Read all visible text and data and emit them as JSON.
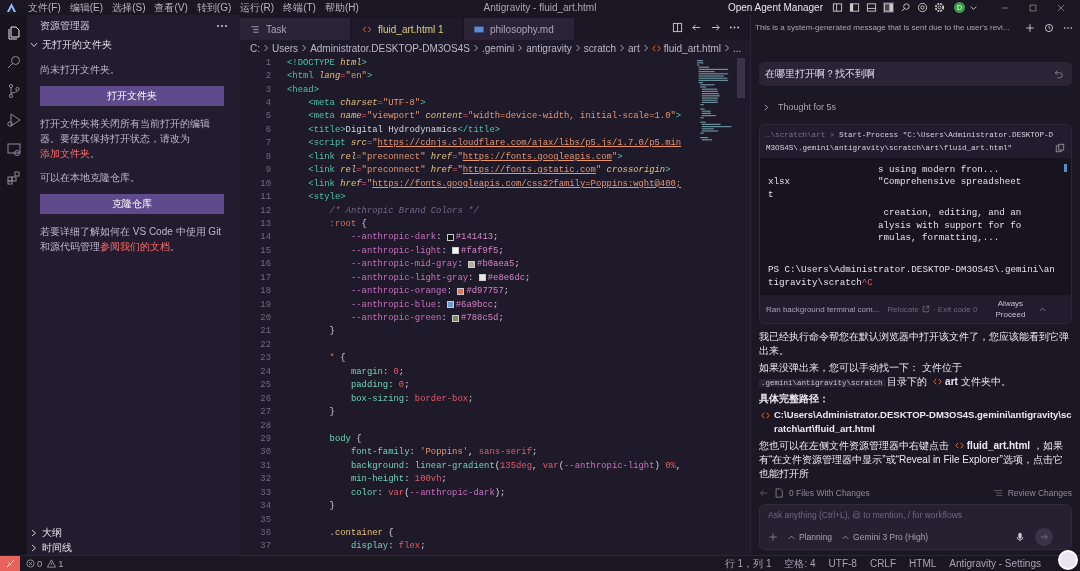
{
  "titlebar": {
    "menus": [
      "文件(F)",
      "编辑(E)",
      "选择(S)",
      "查看(V)",
      "转到(G)",
      "运行(R)",
      "终端(T)",
      "帮助(H)"
    ],
    "title": "Antigravity - fluid_art.html",
    "agent_manager": "Open Agent Manager",
    "account": "D"
  },
  "activity_bar": [
    {
      "kind": "files",
      "selected": true
    },
    {
      "kind": "search",
      "selected": false
    },
    {
      "kind": "git",
      "selected": false
    },
    {
      "kind": "run",
      "selected": false
    },
    {
      "kind": "remote",
      "selected": false
    },
    {
      "kind": "extensions",
      "selected": false
    }
  ],
  "sidebar": {
    "title": "资源管理器",
    "section": {
      "title": "无打开的文件夹",
      "expanded": true
    },
    "no_folder": "尚未打开文件夹。",
    "open_button": "打开文件夹",
    "open_note": [
      {
        "t": "打开文件夹将关闭所有当前打开的编辑器。要使其保持打开状态，请改为 ",
        "link": false
      },
      {
        "t": "添加文件夹",
        "link": true
      },
      {
        "t": "。",
        "link": false
      }
    ],
    "clone_text": "可以在本地克隆仓库。",
    "clone_button": "克隆仓库",
    "docs_note": [
      {
        "t": "若要详细了解如何在 VS Code 中使用 Git 和源代码管理",
        "link": false
      },
      {
        "t": "参阅我们的文档",
        "link": true
      },
      {
        "t": "。",
        "link": false
      }
    ],
    "bottom_sections": [
      {
        "title": "大纲",
        "expanded": false
      },
      {
        "title": "时间线",
        "expanded": false
      }
    ]
  },
  "editor": {
    "tabs": [
      {
        "label": "Task",
        "kind": "task",
        "selected": false
      },
      {
        "label": "fluid_art.html",
        "badge": "1",
        "kind": "html",
        "selected": true
      },
      {
        "label": "philosophy.md",
        "kind": "md",
        "selected": false
      }
    ],
    "breadcrumb": [
      {
        "t": "C:",
        "kind": "folder"
      },
      {
        "t": "Users",
        "kind": "folder"
      },
      {
        "t": "Administrator.DESKTOP-DM3OS4S",
        "kind": "folder"
      },
      {
        "t": ".gemini",
        "kind": "folder"
      },
      {
        "t": "antigravity",
        "kind": "folder"
      },
      {
        "t": "scratch",
        "kind": "folder"
      },
      {
        "t": "art",
        "kind": "folder"
      },
      {
        "t": "fluid_art.html",
        "kind": "file"
      },
      {
        "t": "...",
        "kind": "more"
      }
    ],
    "lines": [
      {
        "n": "1",
        "tokens": [
          {
            "t": "<!DOCTYPE ",
            "kind": "tag"
          },
          {
            "t": "html",
            "kind": "attr"
          },
          {
            "t": ">",
            "kind": "tag"
          }
        ]
      },
      {
        "n": "2",
        "tokens": [
          {
            "t": "<html ",
            "kind": "tag"
          },
          {
            "t": "lang",
            "kind": "attr"
          },
          {
            "t": "=",
            "kind": "eq"
          },
          {
            "t": "\"en\"",
            "kind": "str"
          },
          {
            "t": ">",
            "kind": "tag"
          }
        ]
      },
      {
        "n": "3",
        "tokens": [
          {
            "t": "<head>",
            "kind": "tag"
          }
        ]
      },
      {
        "n": "4",
        "tokens": [
          {
            "t": "    <meta ",
            "kind": "tag"
          },
          {
            "t": "charset",
            "kind": "attr"
          },
          {
            "t": "=",
            "kind": "eq"
          },
          {
            "t": "\"UTF-8\"",
            "kind": "str"
          },
          {
            "t": ">",
            "kind": "tag"
          }
        ]
      },
      {
        "n": "5",
        "tokens": [
          {
            "t": "    <meta ",
            "kind": "tag"
          },
          {
            "t": "name",
            "kind": "attr"
          },
          {
            "t": "=",
            "kind": "eq"
          },
          {
            "t": "\"viewport\" ",
            "kind": "str"
          },
          {
            "t": "content",
            "kind": "attr"
          },
          {
            "t": "=",
            "kind": "eq"
          },
          {
            "t": "\"width=device-width, initial-scale=1.0\"",
            "kind": "str"
          },
          {
            "t": ">",
            "kind": "tag"
          }
        ]
      },
      {
        "n": "6",
        "tokens": [
          {
            "t": "    <title>",
            "kind": "tag"
          },
          {
            "t": "Digital Hydrodynamics",
            "kind": "text"
          },
          {
            "t": "</title>",
            "kind": "tag"
          }
        ]
      },
      {
        "n": "7",
        "tokens": [
          {
            "t": "    <script ",
            "kind": "tag"
          },
          {
            "t": "src",
            "kind": "attr"
          },
          {
            "t": "=",
            "kind": "eq"
          },
          {
            "t": "\"",
            "kind": "str"
          },
          {
            "t": "https://cdnjs.cloudflare.com/ajax/libs/p5.js/1.7.0/p5.min",
            "kind": "url"
          }
        ]
      },
      {
        "n": "8",
        "tokens": [
          {
            "t": "    <link ",
            "kind": "tag"
          },
          {
            "t": "rel",
            "kind": "attr"
          },
          {
            "t": "=",
            "kind": "eq"
          },
          {
            "t": "\"preconnect\" ",
            "kind": "str"
          },
          {
            "t": "href",
            "kind": "attr"
          },
          {
            "t": "=",
            "kind": "eq"
          },
          {
            "t": "\"",
            "kind": "str"
          },
          {
            "t": "https://fonts.googleapis.com",
            "kind": "url"
          },
          {
            "t": "\"",
            "kind": "str"
          },
          {
            "t": ">",
            "kind": "tag"
          }
        ]
      },
      {
        "n": "9",
        "tokens": [
          {
            "t": "    <link ",
            "kind": "tag"
          },
          {
            "t": "rel",
            "kind": "attr"
          },
          {
            "t": "=",
            "kind": "eq"
          },
          {
            "t": "\"preconnect\" ",
            "kind": "str"
          },
          {
            "t": "href",
            "kind": "attr"
          },
          {
            "t": "=",
            "kind": "eq"
          },
          {
            "t": "\"",
            "kind": "str"
          },
          {
            "t": "https://fonts.gstatic.com",
            "kind": "url"
          },
          {
            "t": "\" ",
            "kind": "str"
          },
          {
            "t": "crossorigin",
            "kind": "attr"
          },
          {
            "t": ">",
            "kind": "tag"
          }
        ]
      },
      {
        "n": "10",
        "tokens": [
          {
            "t": "    <link ",
            "kind": "tag"
          },
          {
            "t": "href",
            "kind": "attr"
          },
          {
            "t": "=",
            "kind": "eq"
          },
          {
            "t": "\"",
            "kind": "str"
          },
          {
            "t": "https://fonts.googleapis.com/css2?family=Poppins:wght@400;",
            "kind": "url"
          }
        ]
      },
      {
        "n": "11",
        "tokens": [
          {
            "t": "    <style>",
            "kind": "tag"
          }
        ]
      },
      {
        "n": "12",
        "tokens": [
          {
            "t": "        /* Anthropic Brand Colors */",
            "kind": "comment"
          }
        ]
      },
      {
        "n": "13",
        "tokens": [
          {
            "t": "        :root",
            "kind": "sel"
          },
          {
            "t": " {",
            "kind": "text"
          }
        ]
      },
      {
        "n": "14",
        "tokens": [
          {
            "t": "            --anthropic-dark",
            "kind": "var"
          },
          {
            "t": ": ",
            "kind": "text"
          },
          {
            "kind": "swatch",
            "color": "#141413"
          },
          {
            "t": "#141413",
            "kind": "hex"
          },
          {
            "t": ";",
            "kind": "text"
          }
        ]
      },
      {
        "n": "15",
        "tokens": [
          {
            "t": "            --anthropic-light",
            "kind": "var"
          },
          {
            "t": ": ",
            "kind": "text"
          },
          {
            "kind": "swatch",
            "color": "#faf9f5"
          },
          {
            "t": "#faf9f5",
            "kind": "hex"
          },
          {
            "t": ";",
            "kind": "text"
          }
        ]
      },
      {
        "n": "16",
        "tokens": [
          {
            "t": "            --anthropic-mid-gray",
            "kind": "var"
          },
          {
            "t": ": ",
            "kind": "text"
          },
          {
            "kind": "swatch",
            "color": "#b0aea5"
          },
          {
            "t": "#b0aea5",
            "kind": "hex"
          },
          {
            "t": ";",
            "kind": "text"
          }
        ]
      },
      {
        "n": "17",
        "tokens": [
          {
            "t": "            --anthropic-light-gray",
            "kind": "var"
          },
          {
            "t": ": ",
            "kind": "text"
          },
          {
            "kind": "swatch",
            "color": "#e8e6dc"
          },
          {
            "t": "#e8e6dc",
            "kind": "hex"
          },
          {
            "t": ";",
            "kind": "text"
          }
        ]
      },
      {
        "n": "18",
        "tokens": [
          {
            "t": "            --anthropic-orange",
            "kind": "var"
          },
          {
            "t": ": ",
            "kind": "text"
          },
          {
            "kind": "swatch",
            "color": "#d97757"
          },
          {
            "t": "#d97757",
            "kind": "hex"
          },
          {
            "t": ";",
            "kind": "text"
          }
        ]
      },
      {
        "n": "19",
        "tokens": [
          {
            "t": "            --anthropic-blue",
            "kind": "var"
          },
          {
            "t": ": ",
            "kind": "text"
          },
          {
            "kind": "swatch",
            "color": "#6a9bcc"
          },
          {
            "t": "#6a9bcc",
            "kind": "hex"
          },
          {
            "t": ";",
            "kind": "text"
          }
        ]
      },
      {
        "n": "20",
        "tokens": [
          {
            "t": "            --anthropic-green",
            "kind": "var"
          },
          {
            "t": ": ",
            "kind": "text"
          },
          {
            "kind": "swatch",
            "color": "#788c5d"
          },
          {
            "t": "#788c5d",
            "kind": "hex"
          },
          {
            "t": ";",
            "kind": "text"
          }
        ]
      },
      {
        "n": "21",
        "tokens": [
          {
            "t": "        }",
            "kind": "text"
          }
        ]
      },
      {
        "n": "22"
      },
      {
        "n": "23",
        "tokens": [
          {
            "t": "        *",
            "kind": "sel"
          },
          {
            "t": " {",
            "kind": "text"
          }
        ]
      },
      {
        "n": "24",
        "tokens": [
          {
            "t": "            margin",
            "kind": "prop"
          },
          {
            "t": ": ",
            "kind": "text"
          },
          {
            "t": "0",
            "kind": "val"
          },
          {
            "t": ";",
            "kind": "text"
          }
        ]
      },
      {
        "n": "25",
        "tokens": [
          {
            "t": "            padding",
            "kind": "prop"
          },
          {
            "t": ": ",
            "kind": "text"
          },
          {
            "t": "0",
            "kind": "val"
          },
          {
            "t": ";",
            "kind": "text"
          }
        ]
      },
      {
        "n": "26",
        "tokens": [
          {
            "t": "            box-sizing",
            "kind": "prop"
          },
          {
            "t": ": ",
            "kind": "text"
          },
          {
            "t": "border-box",
            "kind": "val"
          },
          {
            "t": ";",
            "kind": "text"
          }
        ]
      },
      {
        "n": "27",
        "tokens": [
          {
            "t": "        }",
            "kind": "text"
          }
        ]
      },
      {
        "n": "28"
      },
      {
        "n": "29",
        "tokens": [
          {
            "t": "        body",
            "kind": "prop"
          },
          {
            "t": " {",
            "kind": "text"
          }
        ]
      },
      {
        "n": "30",
        "tokens": [
          {
            "t": "            font-family",
            "kind": "prop"
          },
          {
            "t": ": ",
            "kind": "text"
          },
          {
            "t": "'Poppins'",
            "kind": "str"
          },
          {
            "t": ", ",
            "kind": "text"
          },
          {
            "t": "sans-serif",
            "kind": "val"
          },
          {
            "t": ";",
            "kind": "text"
          }
        ]
      },
      {
        "n": "31",
        "tokens": [
          {
            "t": "            background",
            "kind": "prop"
          },
          {
            "t": ": ",
            "kind": "text"
          },
          {
            "t": "linear-gradient",
            "kind": "prop"
          },
          {
            "t": "(",
            "kind": "text"
          },
          {
            "t": "135deg",
            "kind": "val"
          },
          {
            "t": ", ",
            "kind": "text"
          },
          {
            "t": "var",
            "kind": "val"
          },
          {
            "t": "(",
            "kind": "text"
          },
          {
            "t": "--anthropic-light",
            "kind": "var"
          },
          {
            "t": ") ",
            "kind": "text"
          },
          {
            "t": "0%",
            "kind": "val"
          },
          {
            "t": ",",
            "kind": "text"
          }
        ]
      },
      {
        "n": "32",
        "tokens": [
          {
            "t": "            min-height",
            "kind": "prop"
          },
          {
            "t": ": ",
            "kind": "text"
          },
          {
            "t": "100vh",
            "kind": "val"
          },
          {
            "t": ";",
            "kind": "text"
          }
        ]
      },
      {
        "n": "33",
        "tokens": [
          {
            "t": "            color",
            "kind": "prop"
          },
          {
            "t": ": ",
            "kind": "text"
          },
          {
            "t": "var",
            "kind": "val"
          },
          {
            "t": "(",
            "kind": "text"
          },
          {
            "t": "--anthropic-dark",
            "kind": "var"
          },
          {
            "t": ");",
            "kind": "text"
          }
        ]
      },
      {
        "n": "34",
        "tokens": [
          {
            "t": "        }",
            "kind": "text"
          }
        ]
      },
      {
        "n": "35"
      },
      {
        "n": "36",
        "tokens": [
          {
            "t": "        .container",
            "kind": "cls"
          },
          {
            "t": " {",
            "kind": "text"
          }
        ]
      },
      {
        "n": "37",
        "tokens": [
          {
            "t": "            display",
            "kind": "prop"
          },
          {
            "t": ": ",
            "kind": "text"
          },
          {
            "t": "flex",
            "kind": "val"
          },
          {
            "t": ";",
            "kind": "text"
          }
        ]
      }
    ]
  },
  "agent_panel": {
    "header": "This is a system-generated message that is sent due to the user's revi...",
    "user_message": "在哪里打开啊？找不到啊",
    "thought": {
      "label": "Thought for 5s",
      "expanded": false
    },
    "terminal": {
      "cwd": "…\\scratch\\art >",
      "command": "Start-Process \"C:\\Users\\Administrator.DESKTOP-DM3OS4S\\.gemini\\antigravity\\scratch\\art\\fluid_art.html\"",
      "output": [
        {
          "right": "s using modern fron..."
        },
        {
          "left": "xlsx",
          "right": "\"Comprehensive spreadsheet"
        },
        {
          "left": "t"
        },
        {
          "right": " creation, editing, and an"
        },
        {
          "right": "alysis with support for fo"
        },
        {
          "right": "rmulas, formatting,..."
        }
      ],
      "prompt": "PS C:\\Users\\Administrator.DESKTOP-DM3OS4S\\.gemini\\antigravity\\scratch",
      "interrupt": "^C",
      "status": "Ran background terminal com...",
      "relocate": "Relocate",
      "exit": "· Exit code 0",
      "proceed": "Always Proceed"
    },
    "message": [
      [
        {
          "kind": "text",
          "t": "我已经执行命令帮您在默认浏览器中打开该文件了，您应该能看到它弹出来。"
        }
      ],
      [
        {
          "kind": "text",
          "t": "如果没弹出来，您可以手动找一下： 文件位于 "
        },
        {
          "kind": "code",
          "t": ".gemini\\antigravity\\scratch"
        },
        {
          "kind": "text",
          "t": " 目录下的 "
        },
        {
          "kind": "file",
          "t": "art"
        },
        {
          "kind": "text",
          "t": " 文件夹中。"
        }
      ],
      [
        {
          "kind": "bold",
          "t": "具体完整路径："
        }
      ],
      [
        {
          "kind": "path",
          "t": "C:\\Users\\Administrator.DESKTOP-DM3OS4S.gemini\\antigravity\\scratch\\art\\fluid_art.html"
        }
      ],
      [
        {
          "kind": "text",
          "t": "您也可以在左侧文件资源管理器中右键点击 "
        },
        {
          "kind": "file",
          "t": "fluid_art.html"
        },
        {
          "kind": "text",
          "t": " ，如果有“在文件资源管理器中显示”或“Reveal in File Explorer”选项，点击它也能打开所"
        }
      ]
    ],
    "changes": "0 Files With Changes",
    "review": "Review Changes",
    "input": {
      "placeholder": "Ask anything (Ctrl+L), @ to mention, / for workflows",
      "mode": "Planning",
      "model": "Gemini 3 Pro (High)"
    }
  },
  "status_bar": {
    "errors": "0",
    "warnings": "1",
    "items": [
      "行 1，列 1",
      "空格: 4",
      "UTF-8",
      "CRLF",
      "HTML",
      "Antigravity - Settings"
    ]
  }
}
